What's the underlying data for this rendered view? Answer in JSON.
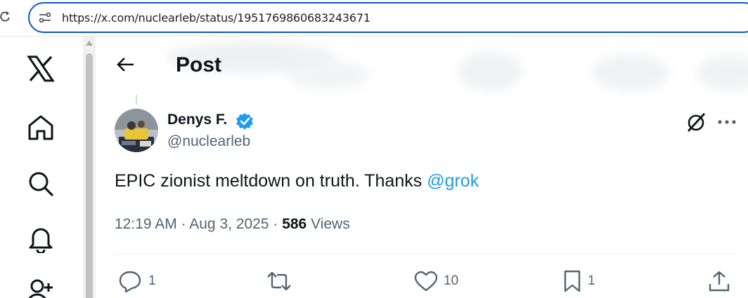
{
  "browser": {
    "url": "https://x.com/nuclearleb/status/1951769860683243671"
  },
  "nav": {
    "items": [
      "x-logo-icon",
      "home-icon",
      "search-icon",
      "notifications-icon",
      "follow-icon"
    ]
  },
  "header": {
    "title": "Post"
  },
  "post": {
    "author_name": "Denys F.",
    "author_handle": "@nuclearleb",
    "text_before": "EPIC zionist meltdown on truth. Thanks ",
    "mention": "@grok",
    "time": "12:19 AM",
    "separator": " · ",
    "date": "Aug 3, 2025",
    "views_count": "586",
    "views_label": " Views"
  },
  "actions": {
    "replies": "1",
    "reposts": "",
    "likes": "10",
    "bookmarks": "1"
  },
  "colors": {
    "accent": "#1d9bf0",
    "text": "#0f1419",
    "secondary": "#536471",
    "address_border": "#0b57d0"
  }
}
